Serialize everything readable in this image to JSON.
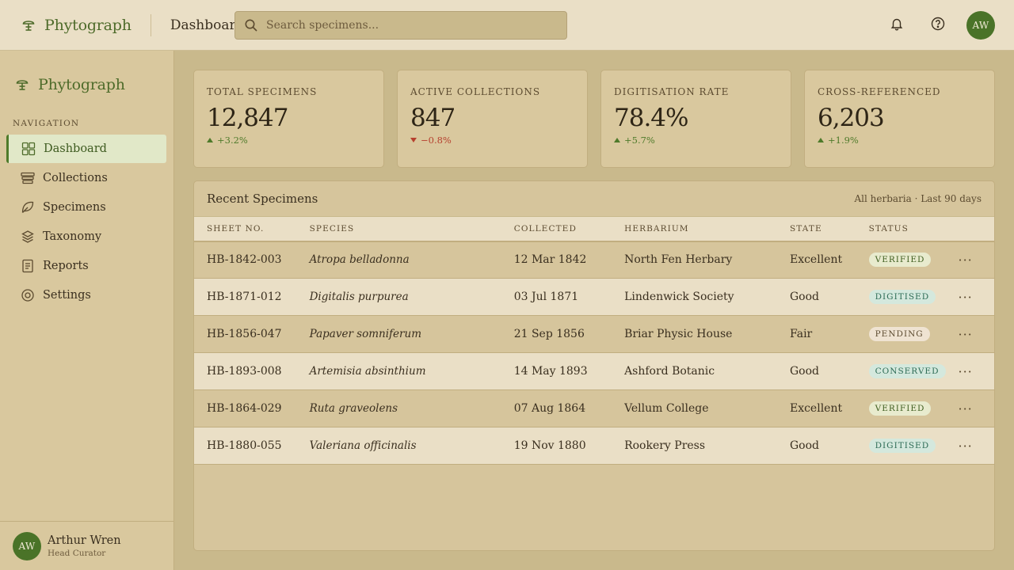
{
  "app": {
    "name": "Phytograph",
    "current_page": "Dashboard"
  },
  "search": {
    "placeholder": "Search specimens..."
  },
  "header": {
    "avatar_initials": "AW"
  },
  "sidebar": {
    "brand": "Phytograph",
    "heading": "NAVIGATION",
    "items": [
      {
        "label": "Dashboard",
        "icon": "grid-icon",
        "active": true
      },
      {
        "label": "Collections",
        "icon": "archive-icon"
      },
      {
        "label": "Specimens",
        "icon": "leaf-icon"
      },
      {
        "label": "Taxonomy",
        "icon": "layers-icon"
      },
      {
        "label": "Reports",
        "icon": "document-icon"
      },
      {
        "label": "Settings",
        "icon": "gear-icon"
      }
    ],
    "user": {
      "initials": "AW",
      "name": "Arthur Wren",
      "role": "Head Curator"
    }
  },
  "stats": [
    {
      "label": "TOTAL SPECIMENS",
      "value": "12,847",
      "delta": "+3.2%",
      "trend": "up"
    },
    {
      "label": "ACTIVE COLLECTIONS",
      "value": "847",
      "delta": "−0.8%",
      "trend": "down"
    },
    {
      "label": "DIGITISATION RATE",
      "value": "78.4%",
      "delta": "+5.7%",
      "trend": "up"
    },
    {
      "label": "CROSS-REFERENCED",
      "value": "6,203",
      "delta": "+1.9%",
      "trend": "up"
    }
  ],
  "table": {
    "title": "Recent Specimens",
    "meta": "All herbaria · Last 90 days",
    "columns": [
      "SHEET NO.",
      "SPECIES",
      "COLLECTED",
      "HERBARIUM",
      "STATE",
      "STATUS"
    ],
    "rows": [
      {
        "sheet": "HB-1842-003",
        "species": "Atropa belladonna",
        "collected": "12 Mar 1842",
        "herbarium": "North Fen Herbary",
        "state": "Excellent",
        "status": "VERIFIED",
        "status_key": "verified"
      },
      {
        "sheet": "HB-1871-012",
        "species": "Digitalis purpurea",
        "collected": "03 Jul 1871",
        "herbarium": "Lindenwick Society",
        "state": "Good",
        "status": "DIGITISED",
        "status_key": "digitised"
      },
      {
        "sheet": "HB-1856-047",
        "species": "Papaver somniferum",
        "collected": "21 Sep 1856",
        "herbarium": "Briar Physic House",
        "state": "Fair",
        "status": "PENDING",
        "status_key": "pending"
      },
      {
        "sheet": "HB-1893-008",
        "species": "Artemisia absinthium",
        "collected": "14 May 1893",
        "herbarium": "Ashford Botanic",
        "state": "Good",
        "status": "CONSERVED",
        "status_key": "conserved"
      },
      {
        "sheet": "HB-1864-029",
        "species": "Ruta graveolens",
        "collected": "07 Aug 1864",
        "herbarium": "Vellum College",
        "state": "Excellent",
        "status": "VERIFIED",
        "status_key": "verified"
      },
      {
        "sheet": "HB-1880-055",
        "species": "Valeriana officinalis",
        "collected": "19 Nov 1880",
        "herbarium": "Rookery Press",
        "state": "Good",
        "status": "DIGITISED",
        "status_key": "digitised"
      }
    ],
    "row_action": "···"
  },
  "colors": {
    "accent": "#4e7a2a",
    "negative": "#b6402e",
    "background": "#c9b98c"
  }
}
